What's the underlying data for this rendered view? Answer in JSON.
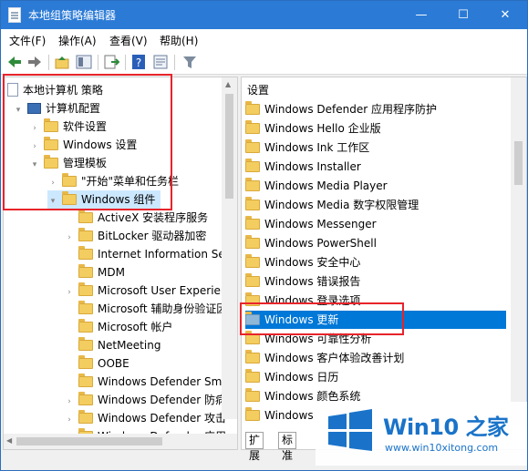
{
  "window": {
    "title": "本地组策略编辑器"
  },
  "titlebar_controls": [
    "—",
    "☐",
    "✕"
  ],
  "menu": [
    "文件(F)",
    "操作(A)",
    "查看(V)",
    "帮助(H)"
  ],
  "left_tree": [
    {
      "label": "本地计算机 策略",
      "indent": 0,
      "arrow": "",
      "icon": "policy-doc"
    },
    {
      "label": "计算机配置",
      "indent": 1,
      "arrow": "▾",
      "icon": "computer"
    },
    {
      "label": "软件设置",
      "indent": 2,
      "arrow": "›",
      "icon": "folder"
    },
    {
      "label": "Windows 设置",
      "indent": 2,
      "arrow": "›",
      "icon": "folder"
    },
    {
      "label": "管理模板",
      "indent": 2,
      "arrow": "▾",
      "icon": "folder"
    },
    {
      "label": "\"开始\"菜单和任务栏",
      "indent": 3,
      "arrow": "›",
      "icon": "folder"
    },
    {
      "label": "Windows 组件",
      "indent": 3,
      "arrow": "▾",
      "icon": "folder",
      "selected": true
    },
    {
      "label": "ActiveX 安装程序服务",
      "indent": 4,
      "arrow": "",
      "icon": "folder"
    },
    {
      "label": "BitLocker 驱动器加密",
      "indent": 4,
      "arrow": "›",
      "icon": "folder"
    },
    {
      "label": "Internet Information Ser",
      "indent": 4,
      "arrow": "",
      "icon": "folder"
    },
    {
      "label": "MDM",
      "indent": 4,
      "arrow": "",
      "icon": "folder"
    },
    {
      "label": "Microsoft User Experien",
      "indent": 4,
      "arrow": "›",
      "icon": "folder"
    },
    {
      "label": "Microsoft 辅助身份验证因",
      "indent": 4,
      "arrow": "",
      "icon": "folder"
    },
    {
      "label": "Microsoft 帐户",
      "indent": 4,
      "arrow": "",
      "icon": "folder"
    },
    {
      "label": "NetMeeting",
      "indent": 4,
      "arrow": "",
      "icon": "folder"
    },
    {
      "label": "OOBE",
      "indent": 4,
      "arrow": "",
      "icon": "folder"
    },
    {
      "label": "Windows Defender Sma",
      "indent": 4,
      "arrow": "",
      "icon": "folder"
    },
    {
      "label": "Windows Defender 防病",
      "indent": 4,
      "arrow": "›",
      "icon": "folder"
    },
    {
      "label": "Windows Defender 攻击",
      "indent": 4,
      "arrow": "›",
      "icon": "folder"
    },
    {
      "label": "Windows Defender 应用",
      "indent": 4,
      "arrow": "›",
      "icon": "folder"
    }
  ],
  "right_list": {
    "header": "设置",
    "items": [
      {
        "label": "Windows Defender 应用程序防护"
      },
      {
        "label": "Windows Hello 企业版"
      },
      {
        "label": "Windows Ink 工作区"
      },
      {
        "label": "Windows Installer"
      },
      {
        "label": "Windows Media Player"
      },
      {
        "label": "Windows Media 数字权限管理"
      },
      {
        "label": "Windows Messenger"
      },
      {
        "label": "Windows PowerShell"
      },
      {
        "label": "Windows 安全中心"
      },
      {
        "label": "Windows 错误报告"
      },
      {
        "label": "Windows 登录选项"
      },
      {
        "label": "Windows 更新",
        "selected": true
      },
      {
        "label": "Windows 可靠性分析"
      },
      {
        "label": "Windows 客户体验改善计划"
      },
      {
        "label": "Windows 日历"
      },
      {
        "label": "Windows 颜色系统"
      },
      {
        "label": "Windows"
      }
    ]
  },
  "tabs": [
    "扩展",
    "标准"
  ],
  "watermark": {
    "title": "Win10 之家",
    "url": "www.win10xitong.com"
  },
  "colors": {
    "titlebar": "#2b7bd6",
    "selection": "#0078d7",
    "highlight_box": "#e8242a"
  }
}
